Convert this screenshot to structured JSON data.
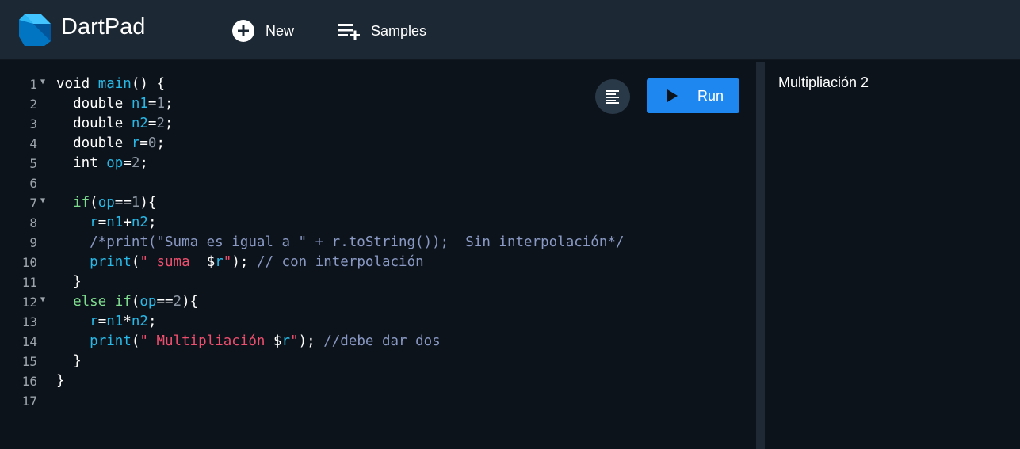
{
  "app": {
    "title": "DartPad"
  },
  "toolbar": {
    "new_label": "New",
    "samples_label": "Samples"
  },
  "editor": {
    "lines": [
      {
        "n": "1",
        "fold": true,
        "tokens": [
          [
            "kw",
            "void "
          ],
          [
            "fn",
            "main"
          ],
          [
            "kw",
            "() {"
          ]
        ]
      },
      {
        "n": "2",
        "fold": false,
        "tokens": [
          [
            "kw",
            "  double "
          ],
          [
            "id",
            "n1"
          ],
          [
            "kw",
            "="
          ],
          [
            "num",
            "1"
          ],
          [
            "kw",
            ";"
          ]
        ]
      },
      {
        "n": "3",
        "fold": false,
        "tokens": [
          [
            "kw",
            "  double "
          ],
          [
            "id",
            "n2"
          ],
          [
            "kw",
            "="
          ],
          [
            "num",
            "2"
          ],
          [
            "kw",
            ";"
          ]
        ]
      },
      {
        "n": "4",
        "fold": false,
        "tokens": [
          [
            "kw",
            "  double "
          ],
          [
            "id",
            "r"
          ],
          [
            "kw",
            "="
          ],
          [
            "num",
            "0"
          ],
          [
            "kw",
            ";"
          ]
        ]
      },
      {
        "n": "5",
        "fold": false,
        "tokens": [
          [
            "kw",
            "  int "
          ],
          [
            "id",
            "op"
          ],
          [
            "kw",
            "="
          ],
          [
            "num",
            "2"
          ],
          [
            "kw",
            ";"
          ]
        ]
      },
      {
        "n": "6",
        "fold": false,
        "tokens": []
      },
      {
        "n": "7",
        "fold": true,
        "tokens": [
          [
            "kw",
            "  "
          ],
          [
            "kw2",
            "if"
          ],
          [
            "kw",
            "("
          ],
          [
            "id",
            "op"
          ],
          [
            "kw",
            "=="
          ],
          [
            "num",
            "1"
          ],
          [
            "kw",
            "){"
          ]
        ]
      },
      {
        "n": "8",
        "fold": false,
        "tokens": [
          [
            "kw",
            "    "
          ],
          [
            "id",
            "r"
          ],
          [
            "kw",
            "="
          ],
          [
            "id",
            "n1"
          ],
          [
            "kw",
            "+"
          ],
          [
            "id",
            "n2"
          ],
          [
            "kw",
            ";"
          ]
        ]
      },
      {
        "n": "9",
        "fold": false,
        "tokens": [
          [
            "cm",
            "    /*print(\"Suma es igual a \" + r.toString());  Sin interpolación*/"
          ]
        ]
      },
      {
        "n": "10",
        "fold": false,
        "tokens": [
          [
            "kw",
            "    "
          ],
          [
            "fn",
            "print"
          ],
          [
            "kw",
            "("
          ],
          [
            "str",
            "\" suma  "
          ],
          [
            "kw",
            "$"
          ],
          [
            "id",
            "r"
          ],
          [
            "str",
            "\""
          ],
          [
            "kw",
            "); "
          ],
          [
            "cm",
            "// con interpolación"
          ]
        ]
      },
      {
        "n": "11",
        "fold": false,
        "tokens": [
          [
            "kw",
            "  }"
          ]
        ]
      },
      {
        "n": "12",
        "fold": true,
        "tokens": [
          [
            "kw",
            "  "
          ],
          [
            "kw2",
            "else if"
          ],
          [
            "kw",
            "("
          ],
          [
            "id",
            "op"
          ],
          [
            "kw",
            "=="
          ],
          [
            "num",
            "2"
          ],
          [
            "kw",
            "){"
          ]
        ]
      },
      {
        "n": "13",
        "fold": false,
        "tokens": [
          [
            "kw",
            "    "
          ],
          [
            "id",
            "r"
          ],
          [
            "kw",
            "="
          ],
          [
            "id",
            "n1"
          ],
          [
            "kw",
            "*"
          ],
          [
            "id",
            "n2"
          ],
          [
            "kw",
            ";"
          ]
        ]
      },
      {
        "n": "14",
        "fold": false,
        "tokens": [
          [
            "kw",
            "    "
          ],
          [
            "fn",
            "print"
          ],
          [
            "kw",
            "("
          ],
          [
            "str",
            "\" Multipliación "
          ],
          [
            "kw",
            "$"
          ],
          [
            "id",
            "r"
          ],
          [
            "str",
            "\""
          ],
          [
            "kw",
            "); "
          ],
          [
            "cm",
            "//debe dar dos"
          ]
        ]
      },
      {
        "n": "15",
        "fold": false,
        "tokens": [
          [
            "kw",
            "  }"
          ]
        ]
      },
      {
        "n": "16",
        "fold": false,
        "tokens": [
          [
            "kw",
            "}"
          ]
        ]
      },
      {
        "n": "17",
        "fold": false,
        "tokens": []
      }
    ]
  },
  "actions": {
    "run_label": "Run",
    "format_icon": "format-align-icon",
    "run_icon": "play-icon"
  },
  "console": {
    "output": "Multipliación 2"
  },
  "colors": {
    "topbar": "#1c2834",
    "background": "#0c131b",
    "run_button": "#1e88f0",
    "keyword_green": "#7fdc8f",
    "identifier_blue": "#2ab8e6",
    "string_red": "#ee4f6e",
    "comment": "#8a99c4"
  }
}
